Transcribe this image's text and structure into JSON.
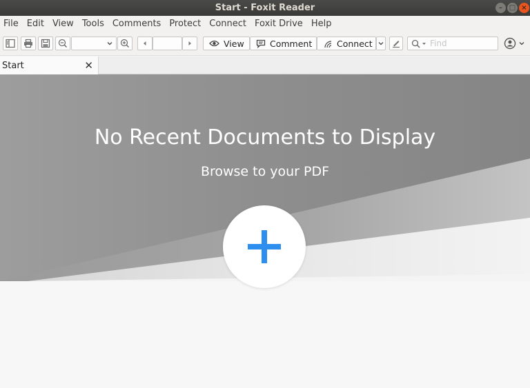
{
  "window": {
    "title": "Start - Foxit Reader"
  },
  "menu": [
    "File",
    "Edit",
    "View",
    "Tools",
    "Comments",
    "Protect",
    "Connect",
    "Foxit Drive",
    "Help"
  ],
  "toolbar": {
    "view_label": "View",
    "comment_label": "Comment",
    "connect_label": "Connect",
    "find_placeholder": "Find"
  },
  "tabs": [
    {
      "label": "Start"
    }
  ],
  "start_page": {
    "headline": "No Recent Documents to Display",
    "subline": "Browse to your PDF"
  },
  "colors": {
    "accent_plus": "#2d8ef0",
    "banner_gray": "#8c8c8c",
    "close_button": "#e9541f"
  },
  "icons": {
    "add": "plus-icon",
    "find": "search-icon",
    "view": "eye-icon",
    "comment": "comment-icon",
    "connect": "connect-icon"
  }
}
